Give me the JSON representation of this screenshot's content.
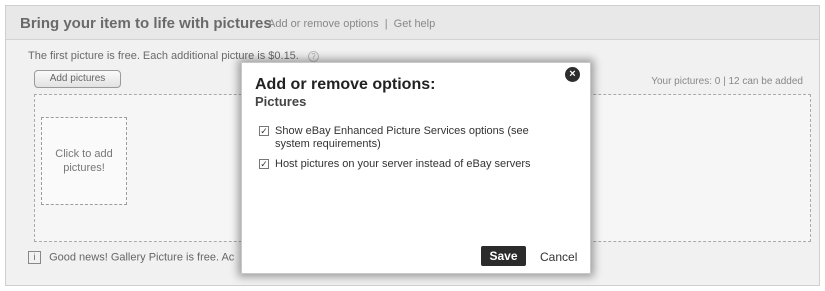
{
  "panel": {
    "title": "Bring your item to life with pictures",
    "links": [
      "Add or remove options",
      "Get help"
    ],
    "link_separator": "|",
    "info_text": "The first picture is free. Each additional picture is $0.15.",
    "help_icon": "?",
    "add_button_label": "Add pictures",
    "pictures_count_text": "Your pictures: 0 | 12 can be added",
    "click_box_text": "Click to add pictures!",
    "info_icon": "i",
    "good_news_text": "Good news! Gallery Picture is free. Ac"
  },
  "modal": {
    "title": "Add or remove options:",
    "subtitle": "Pictures",
    "close_glyph": "×",
    "options": [
      {
        "label": "Show eBay Enhanced Picture Services options (see system requirements)",
        "checked": true
      },
      {
        "label": "Host pictures on your server instead of eBay servers",
        "checked": true
      }
    ],
    "check_glyph": "✓",
    "save_label": "Save",
    "cancel_label": "Cancel"
  }
}
